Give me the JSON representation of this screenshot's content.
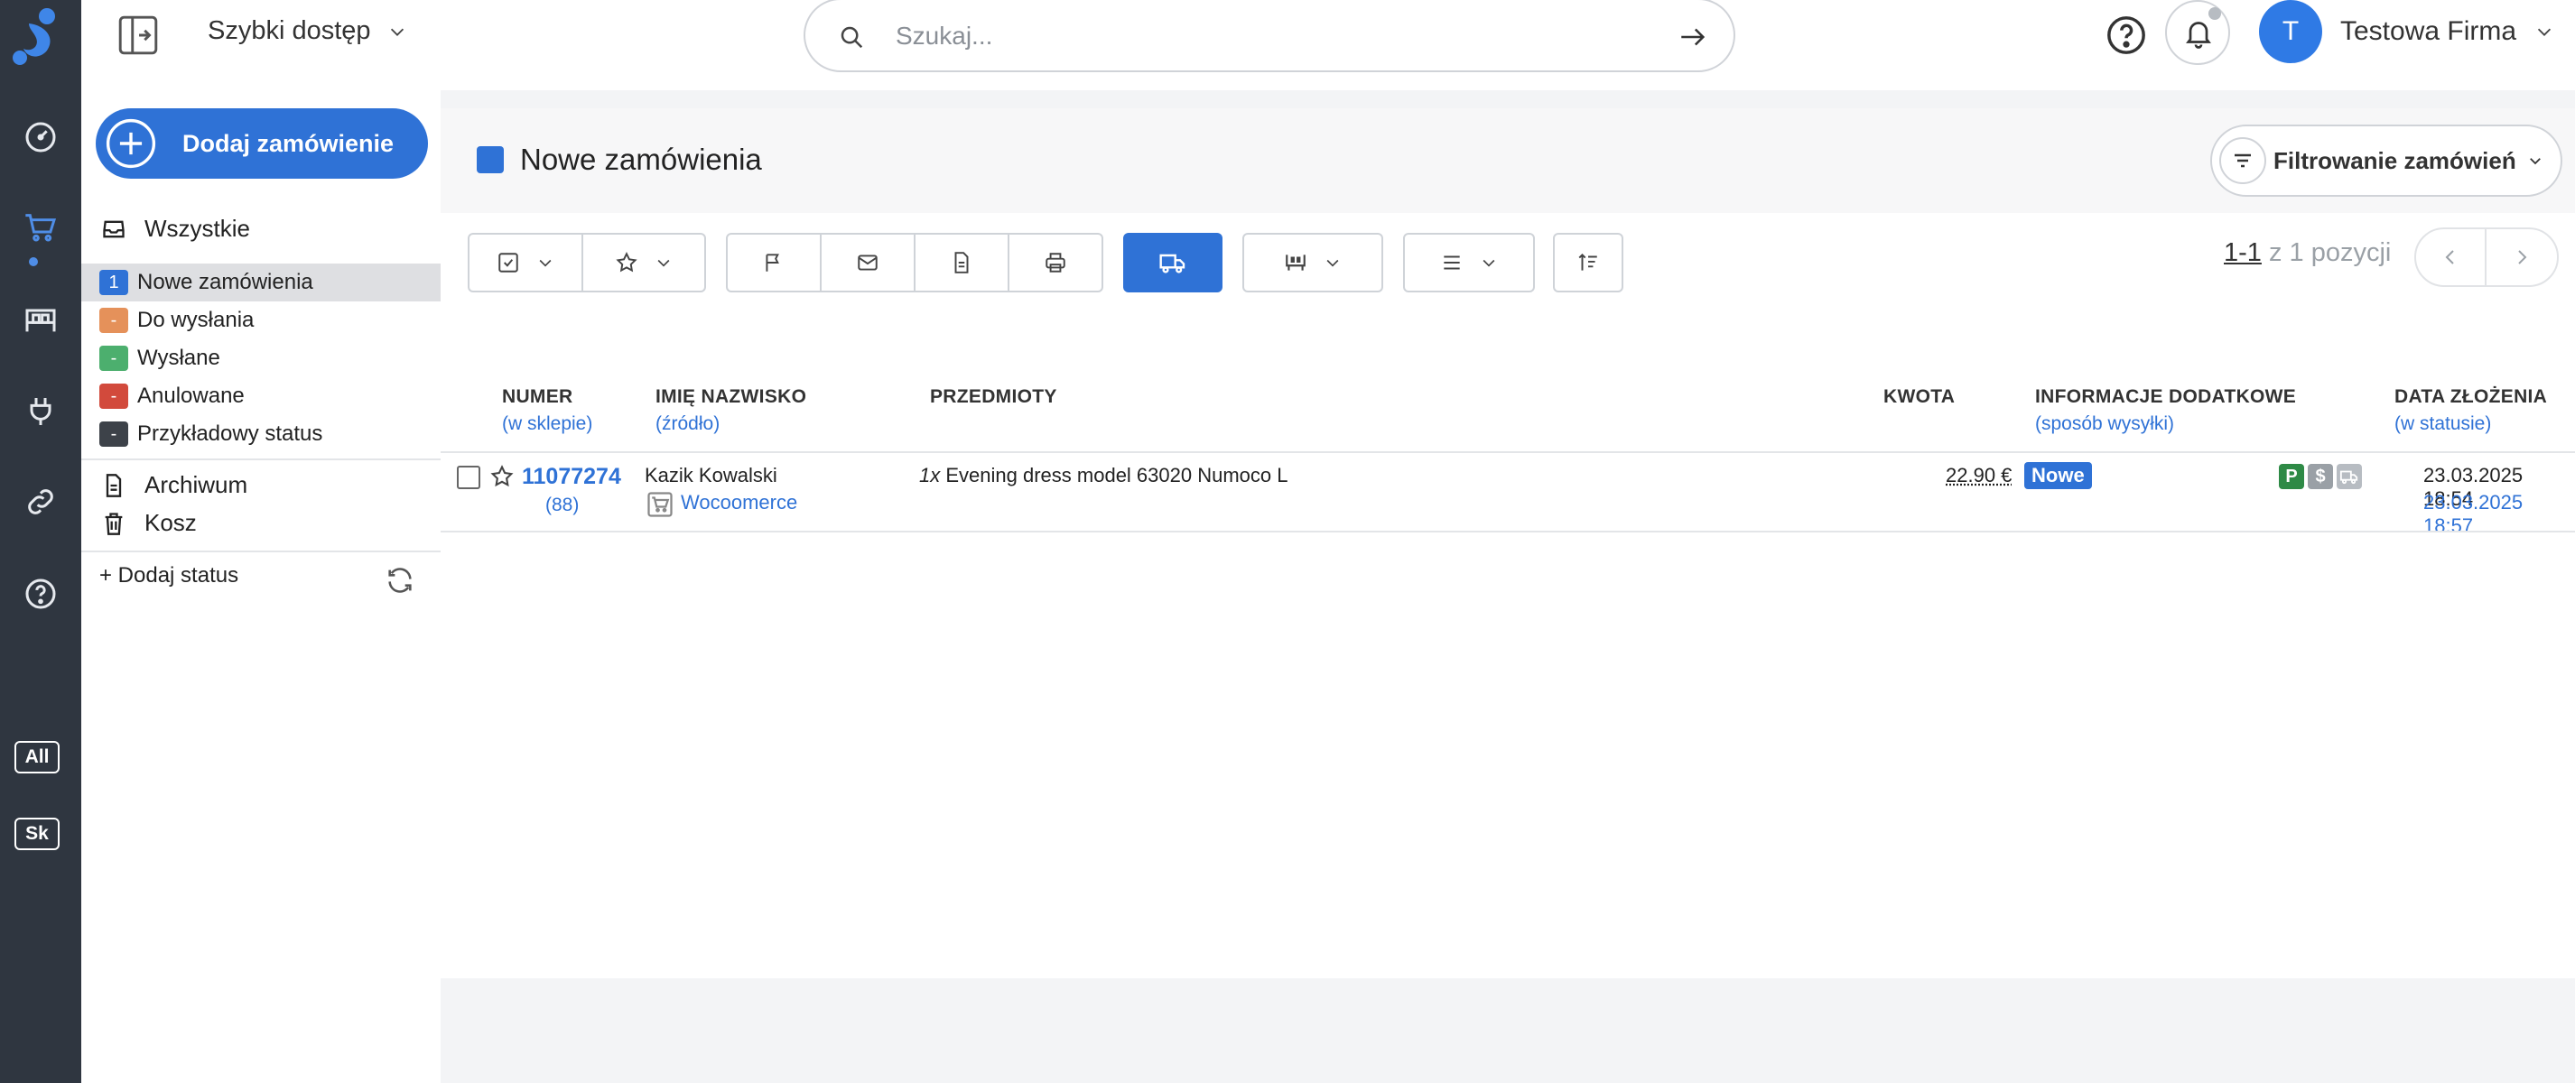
{
  "topbar": {
    "quick_access": "Szybki dostęp",
    "search_placeholder": "Szukaj...",
    "avatar_initial": "T",
    "company_name": "Testowa Firma"
  },
  "rail": {
    "badges": [
      "All",
      "Sk"
    ]
  },
  "sidebar": {
    "add_order_label": "Dodaj zamówienie",
    "all_label": "Wszystkie",
    "statuses": [
      {
        "badge": "1",
        "label": "Nowe zamówienia",
        "color": "#2f72d6"
      },
      {
        "badge": "-",
        "label": "Do wysłania",
        "color": "#e5915a"
      },
      {
        "badge": "-",
        "label": "Wysłane",
        "color": "#4caf6e"
      },
      {
        "badge": "-",
        "label": "Anulowane",
        "color": "#d24a3c"
      },
      {
        "badge": "-",
        "label": "Przykładowy status",
        "color": "#3d4249"
      }
    ],
    "archive_label": "Archiwum",
    "trash_label": "Kosz",
    "add_status_label": "+ Dodaj status"
  },
  "main": {
    "title": "Nowe zamówienia",
    "filter_label": "Filtrowanie zamówień",
    "pager": {
      "range": "1-1",
      "rest": "z 1 pozycji"
    },
    "columns": [
      {
        "title": "NUMER",
        "sub": "(w sklepie)"
      },
      {
        "title": "IMIĘ NAZWISKO",
        "sub": "(źródło)"
      },
      {
        "title": "PRZEDMIOTY",
        "sub": ""
      },
      {
        "title": "KWOTA",
        "sub": ""
      },
      {
        "title": "INFORMACJE DODATKOWE",
        "sub": "(sposób wysyłki)"
      },
      {
        "title": "DATA ZŁOŻENIA",
        "sub": "(w statusie)"
      }
    ],
    "rows": [
      {
        "number": "11077274",
        "shop_number": "(88)",
        "name": "Kazik Kowalski",
        "source": "Wocoomerce",
        "qty": "1x",
        "item": "Evening dress model 63020 Numoco L",
        "amount": "22.90 €",
        "status_badge": "Nowe",
        "icons": [
          {
            "label": "P",
            "color": "#2e8a46"
          },
          {
            "label": "$",
            "color": "#9aa0a6"
          },
          {
            "label": "truck-icon",
            "color": "#b7bcc2"
          }
        ],
        "date_created": "23.03.2025 18:54",
        "date_status": "23.03.2025 18:57"
      }
    ]
  }
}
